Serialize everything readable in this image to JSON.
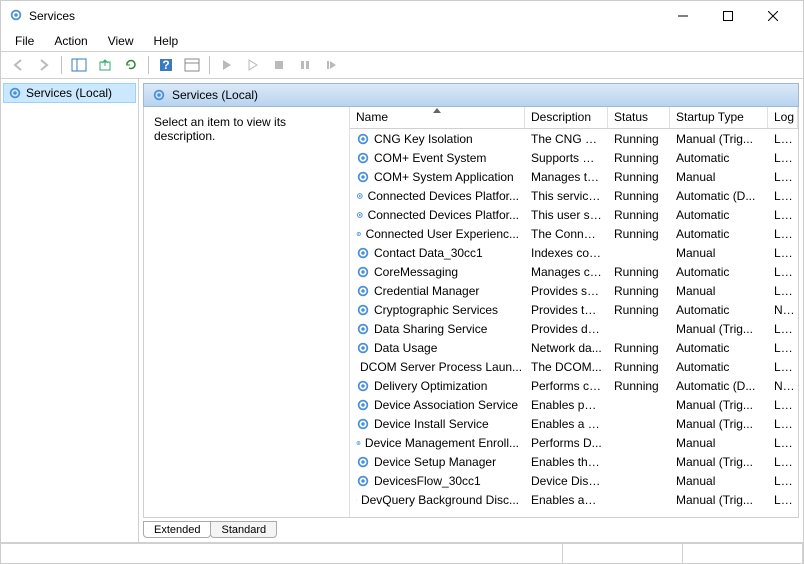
{
  "window": {
    "title": "Services"
  },
  "menu": [
    "File",
    "Action",
    "View",
    "Help"
  ],
  "toolbar_icons": [
    "back",
    "forward",
    "|",
    "up",
    "export",
    "refresh",
    "|",
    "help",
    "properties",
    "|",
    "start",
    "pause",
    "stop",
    "restart",
    "step"
  ],
  "tree": {
    "root": "Services (Local)"
  },
  "panel": {
    "header": "Services (Local)",
    "hint": "Select an item to view its description."
  },
  "columns": [
    {
      "key": "name",
      "label": "Name",
      "sorted": true
    },
    {
      "key": "desc",
      "label": "Description"
    },
    {
      "key": "status",
      "label": "Status"
    },
    {
      "key": "startup",
      "label": "Startup Type"
    },
    {
      "key": "log",
      "label": "Log"
    }
  ],
  "services": [
    {
      "name": "CNG Key Isolation",
      "desc": "The CNG ke...",
      "status": "Running",
      "startup": "Manual (Trig...",
      "log": "Loc"
    },
    {
      "name": "COM+ Event System",
      "desc": "Supports Sy...",
      "status": "Running",
      "startup": "Automatic",
      "log": "Loc"
    },
    {
      "name": "COM+ System Application",
      "desc": "Manages th...",
      "status": "Running",
      "startup": "Manual",
      "log": "Loc"
    },
    {
      "name": "Connected Devices Platfor...",
      "desc": "This service ...",
      "status": "Running",
      "startup": "Automatic (D...",
      "log": "Loc"
    },
    {
      "name": "Connected Devices Platfor...",
      "desc": "This user se...",
      "status": "Running",
      "startup": "Automatic",
      "log": "Loc"
    },
    {
      "name": "Connected User Experienc...",
      "desc": "The Connec...",
      "status": "Running",
      "startup": "Automatic",
      "log": "Loc"
    },
    {
      "name": "Contact Data_30cc1",
      "desc": "Indexes con...",
      "status": "",
      "startup": "Manual",
      "log": "Loc"
    },
    {
      "name": "CoreMessaging",
      "desc": "Manages co...",
      "status": "Running",
      "startup": "Automatic",
      "log": "Loc"
    },
    {
      "name": "Credential Manager",
      "desc": "Provides se...",
      "status": "Running",
      "startup": "Manual",
      "log": "Loc"
    },
    {
      "name": "Cryptographic Services",
      "desc": "Provides thr...",
      "status": "Running",
      "startup": "Automatic",
      "log": "Net"
    },
    {
      "name": "Data Sharing Service",
      "desc": "Provides da...",
      "status": "",
      "startup": "Manual (Trig...",
      "log": "Loc"
    },
    {
      "name": "Data Usage",
      "desc": "Network da...",
      "status": "Running",
      "startup": "Automatic",
      "log": "Loc"
    },
    {
      "name": "DCOM Server Process Laun...",
      "desc": "The DCOM...",
      "status": "Running",
      "startup": "Automatic",
      "log": "Loc"
    },
    {
      "name": "Delivery Optimization",
      "desc": "Performs co...",
      "status": "Running",
      "startup": "Automatic (D...",
      "log": "Net"
    },
    {
      "name": "Device Association Service",
      "desc": "Enables pair...",
      "status": "",
      "startup": "Manual (Trig...",
      "log": "Loc"
    },
    {
      "name": "Device Install Service",
      "desc": "Enables a c...",
      "status": "",
      "startup": "Manual (Trig...",
      "log": "Loc"
    },
    {
      "name": "Device Management Enroll...",
      "desc": "Performs D...",
      "status": "",
      "startup": "Manual",
      "log": "Loc"
    },
    {
      "name": "Device Setup Manager",
      "desc": "Enables the ...",
      "status": "",
      "startup": "Manual (Trig...",
      "log": "Loc"
    },
    {
      "name": "DevicesFlow_30cc1",
      "desc": "Device Disc...",
      "status": "",
      "startup": "Manual",
      "log": "Loc"
    },
    {
      "name": "DevQuery Background Disc...",
      "desc": "Enables app...",
      "status": "",
      "startup": "Manual (Trig...",
      "log": "Loc"
    }
  ],
  "tabs": {
    "extended": "Extended",
    "standard": "Standard"
  }
}
